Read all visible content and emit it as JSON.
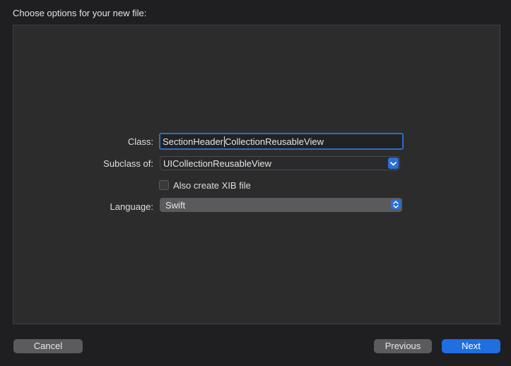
{
  "dialog": {
    "title": "Choose options for your new file:"
  },
  "form": {
    "class_label": "Class:",
    "class_value_before_caret": "SectionHeader",
    "class_value_after_caret": "CollectionReusableView",
    "subclass_label": "Subclass of:",
    "subclass_value": "UICollectionReusableView",
    "xib_label": "Also create XIB file",
    "xib_checked": false,
    "language_label": "Language:",
    "language_value": "Swift"
  },
  "buttons": {
    "cancel": "Cancel",
    "previous": "Previous",
    "next": "Next"
  },
  "icons": {
    "combo_arrow": "chevron-down-icon",
    "select_arrow": "up-down-chevron-icon"
  },
  "colors": {
    "accent": "#1f6fe0",
    "focus_ring": "#2d6ec2",
    "panel": "#2c2c2d",
    "window": "#1f1f21"
  }
}
